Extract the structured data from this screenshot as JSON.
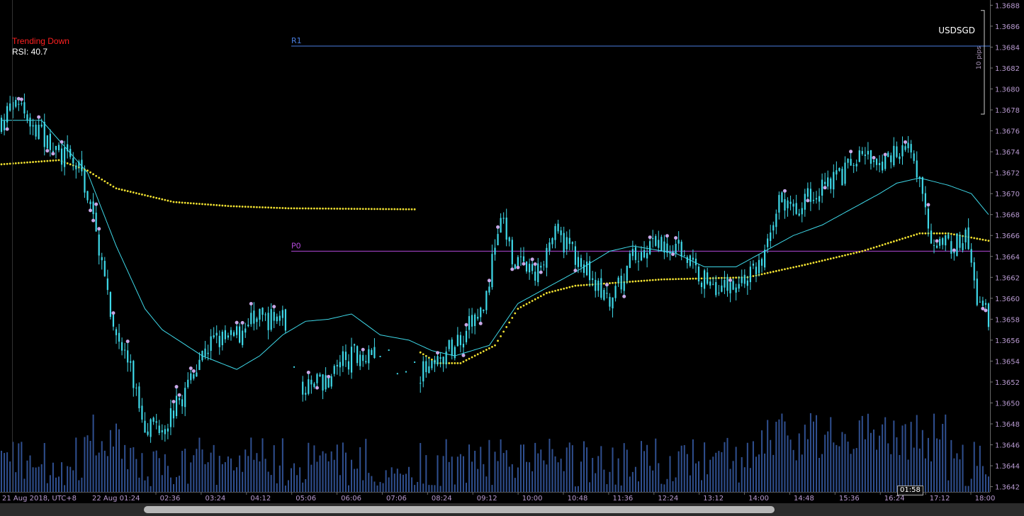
{
  "symbol": "USDSGD",
  "indicators": {
    "trend": "Trending Down",
    "rsi": "RSI: 40.7"
  },
  "pips_label": "10 pips",
  "cursor_time": "01:58",
  "colors": {
    "background": "#000000",
    "candle": "#3ed8e8",
    "wick_marker": "#c9a8e8",
    "ma_slow": "#f0e030",
    "ma_fast": "#3ed8e8",
    "volume": "#2f4f8f",
    "pivot_p0": "#b24ad8",
    "pivot_r1": "#4a7ee0",
    "axis_text": "#b89ad0",
    "trend_text": "#ff2020"
  },
  "chart_data": {
    "type": "candlestick",
    "symbol": "USDSGD",
    "ylim": [
      1.36415,
      1.36885
    ],
    "y_ticks": [
      "1.3688",
      "1.3686",
      "1.3684",
      "1.3682",
      "1.3680",
      "1.3678",
      "1.3676",
      "1.3674",
      "1.3672",
      "1.3670",
      "1.3668",
      "1.3666",
      "1.3664",
      "1.3662",
      "1.3660",
      "1.3658",
      "1.3656",
      "1.3654",
      "1.3652",
      "1.3650",
      "1.3648",
      "1.3646",
      "1.3644",
      "1.3642"
    ],
    "x_ticks": [
      "21 Aug 2018, UTC+8",
      "22 Aug 01:24",
      "02:36",
      "03:24",
      "04:12",
      "05:06",
      "06:06",
      "07:06",
      "08:24",
      "09:12",
      "10:00",
      "10:48",
      "11:36",
      "12:24",
      "13:12",
      "14:00",
      "14:48",
      "15:36",
      "16:24",
      "17:12",
      "18:00"
    ],
    "pivot_lines": [
      {
        "name": "R1",
        "price": 1.36841
      },
      {
        "name": "P0",
        "price": 1.36645
      }
    ],
    "close_anchors": [
      [
        0,
        1.3677
      ],
      [
        6,
        1.3679
      ],
      [
        12,
        1.3676
      ],
      [
        20,
        1.3674
      ],
      [
        28,
        1.3672
      ],
      [
        34,
        1.3665
      ],
      [
        38,
        1.3658
      ],
      [
        44,
        1.3654
      ],
      [
        50,
        1.3648
      ],
      [
        57,
        1.3648
      ],
      [
        64,
        1.3651
      ],
      [
        68,
        1.3654
      ],
      [
        74,
        1.3656
      ],
      [
        80,
        1.3656
      ],
      [
        88,
        1.3658
      ],
      [
        98,
        1.3658
      ],
      [
        106,
        1.3651
      ],
      [
        112,
        1.3652
      ],
      [
        119,
        1.3654
      ],
      [
        126,
        1.3655
      ],
      [
        133,
        1.3655
      ],
      [
        142,
        1.3653
      ],
      [
        150,
        1.3653
      ],
      [
        156,
        1.3655
      ],
      [
        162,
        1.3657
      ],
      [
        168,
        1.3659
      ],
      [
        174,
        1.3668
      ],
      [
        178,
        1.3664
      ],
      [
        186,
        1.3662
      ],
      [
        192,
        1.3666
      ],
      [
        198,
        1.3665
      ],
      [
        206,
        1.3662
      ],
      [
        212,
        1.3659
      ],
      [
        220,
        1.3664
      ],
      [
        230,
        1.3665
      ],
      [
        236,
        1.3665
      ],
      [
        244,
        1.3662
      ],
      [
        252,
        1.3661
      ],
      [
        260,
        1.3662
      ],
      [
        266,
        1.3664
      ],
      [
        270,
        1.3669
      ],
      [
        278,
        1.3669
      ],
      [
        286,
        1.3671
      ],
      [
        294,
        1.3672
      ],
      [
        300,
        1.3674
      ],
      [
        306,
        1.3672
      ],
      [
        314,
        1.3675
      ],
      [
        318,
        1.3673
      ],
      [
        324,
        1.3666
      ],
      [
        330,
        1.3665
      ],
      [
        336,
        1.3666
      ],
      [
        340,
        1.366
      ],
      [
        344,
        1.3658
      ]
    ],
    "gaps": [
      [
        100,
        104
      ],
      [
        131,
        145
      ]
    ],
    "ma_slow_anchors": [
      [
        0,
        1.36728
      ],
      [
        20,
        1.36732
      ],
      [
        30,
        1.36722
      ],
      [
        40,
        1.36705
      ],
      [
        60,
        1.36692
      ],
      [
        80,
        1.36688
      ],
      [
        100,
        1.36686
      ],
      [
        144,
        1.36685
      ],
      [
        145,
        1.3655
      ],
      [
        152,
        1.36538
      ],
      [
        160,
        1.36538
      ],
      [
        172,
        1.36555
      ],
      [
        180,
        1.3659
      ],
      [
        190,
        1.36605
      ],
      [
        200,
        1.36612
      ],
      [
        230,
        1.36618
      ],
      [
        260,
        1.3662
      ],
      [
        280,
        1.36632
      ],
      [
        300,
        1.36645
      ],
      [
        320,
        1.36662
      ],
      [
        330,
        1.36662
      ],
      [
        344,
        1.36655
      ]
    ],
    "ma_fast_anchors": [
      [
        0,
        1.3677
      ],
      [
        14,
        1.3677
      ],
      [
        22,
        1.36745
      ],
      [
        30,
        1.3672
      ],
      [
        40,
        1.3665
      ],
      [
        50,
        1.3659
      ],
      [
        56,
        1.3657
      ],
      [
        70,
        1.36545
      ],
      [
        82,
        1.36532
      ],
      [
        90,
        1.36545
      ],
      [
        98,
        1.36565
      ],
      [
        106,
        1.36578
      ],
      [
        114,
        1.3658
      ],
      [
        122,
        1.36585
      ],
      [
        132,
        1.36565
      ],
      [
        142,
        1.3656
      ],
      [
        150,
        1.3655
      ],
      [
        158,
        1.36545
      ],
      [
        170,
        1.36555
      ],
      [
        180,
        1.36595
      ],
      [
        190,
        1.3661
      ],
      [
        200,
        1.36625
      ],
      [
        212,
        1.36645
      ],
      [
        220,
        1.3665
      ],
      [
        235,
        1.36643
      ],
      [
        245,
        1.3663
      ],
      [
        256,
        1.3663
      ],
      [
        266,
        1.36645
      ],
      [
        276,
        1.3666
      ],
      [
        286,
        1.3667
      ],
      [
        296,
        1.36685
      ],
      [
        306,
        1.367
      ],
      [
        312,
        1.3671
      ],
      [
        320,
        1.36715
      ],
      [
        330,
        1.36708
      ],
      [
        338,
        1.367
      ],
      [
        344,
        1.3668
      ]
    ],
    "volume_ratio_range": [
      0.05,
      1.0
    ]
  }
}
